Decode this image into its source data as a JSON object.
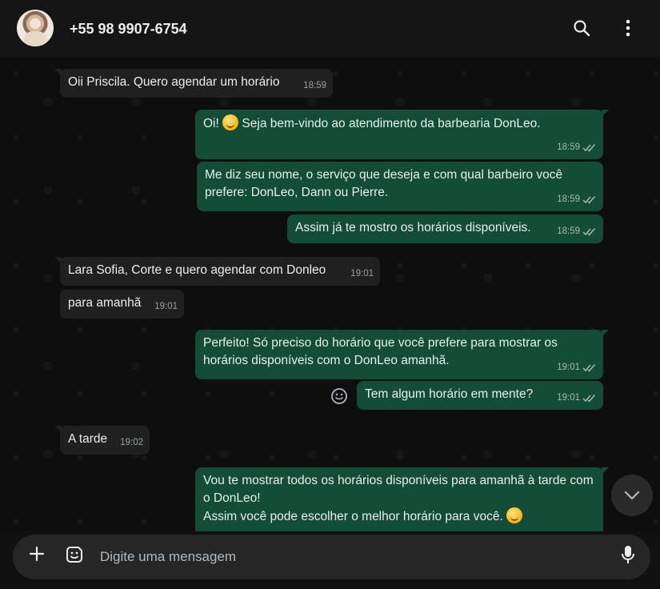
{
  "header": {
    "contact": "+55 98 9907-6754",
    "icons": [
      "avatar",
      "search-icon",
      "menu-icon"
    ]
  },
  "messages": [
    {
      "dir": "in",
      "text": "Oii Priscila. Quero agendar um horário",
      "time": "18:59"
    },
    {
      "dir": "out",
      "text_before": "Oi! ",
      "emoji": "grinning-face-emoji",
      "text_after": " Seja bem-vindo ao atendimento da barbearia DonLeo.",
      "time": "18:59",
      "status": "read"
    },
    {
      "dir": "out",
      "text": "Me diz seu nome, o serviço que deseja e com qual barbeiro você prefere: DonLeo, Dann ou Pierre.",
      "time": "18:59",
      "status": "read"
    },
    {
      "dir": "out",
      "text": "Assim já te mostro os horários disponíveis.",
      "time": "18:59",
      "status": "read"
    },
    {
      "dir": "in",
      "text": "Lara Sofia, Corte e quero agendar com Donleo",
      "time": "19:01"
    },
    {
      "dir": "in",
      "text": "para amanhã",
      "time": "19:01"
    },
    {
      "dir": "out",
      "text": "Perfeito! Só preciso do horário que você prefere para mostrar os horários disponíveis com o DonLeo amanhã.",
      "time": "19:01",
      "status": "read"
    },
    {
      "dir": "out",
      "text": "Tem algum horário em mente?",
      "time": "19:01",
      "status": "read"
    },
    {
      "dir": "in",
      "text": "A tarde",
      "time": "19:02"
    },
    {
      "dir": "out",
      "line1": "Vou te mostrar todos os horários disponíveis para amanhã à tarde com o DonLeo!",
      "line2": "Assim você pode escolher o melhor horário para você.",
      "emoji": "smiling-face-emoji"
    }
  ],
  "composer": {
    "placeholder": "Digite uma mensagem"
  },
  "colors": {
    "outgoing_bubble": "#134d37",
    "incoming_bubble": "#202020",
    "background": "#111111"
  }
}
